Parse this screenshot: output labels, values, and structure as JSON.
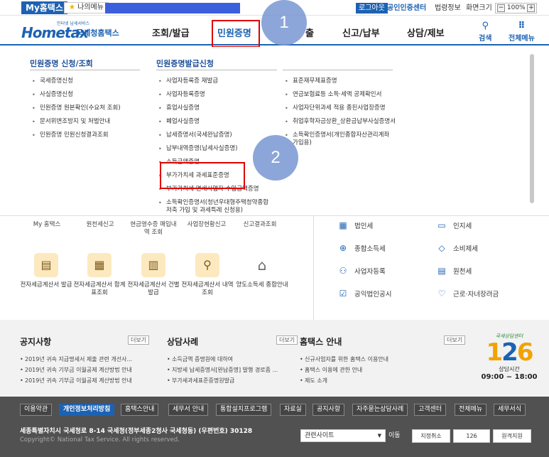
{
  "topbar": {
    "my_hometax": "My홈택스",
    "my_menu_star": "★",
    "my_menu": "나의메뉴",
    "logout": "로그아웃",
    "cert_center": "공인인증센터",
    "legal": "법령정보",
    "zoom_label": "화면크기",
    "zoom_minus": "−",
    "zoom_value": "100%",
    "zoom_plus": "+"
  },
  "header": {
    "logo_word": "Hometax",
    "logo_sub": "인터넷 납세서비스",
    "logo_kr": "국세청홈택스",
    "nav": [
      "조회/발급",
      "민원증명",
      "신청/제출",
      "신고/납부",
      "상담/제보"
    ],
    "nav_visible": [
      "조회/발급",
      "민원증명",
      "출",
      "신고/납부",
      "상담/제보"
    ],
    "search": "검색",
    "search_icon": "⚲",
    "all_menu": "전체메뉴",
    "all_menu_icon": "⠿"
  },
  "annotations": {
    "step1": "1",
    "step2": "2"
  },
  "dropdown": {
    "col1_title": "민원증명 신청/조회",
    "col1_items": [
      "국세증명신청",
      "사실증명신청",
      "민원증명 원본확인(수요처 조회)",
      "문서위변조방지 및 처벌안내",
      "민원증명 민원신청결과조회"
    ],
    "col2_title": "민원증명발급신청",
    "col2_items": [
      "사업자등록증 재발급",
      "사업자등록증명",
      "휴업사실증명",
      "폐업사실증명",
      "납세증명서(국세완납증명)",
      "납부내역증명(납세사실증명)",
      "소득금액증명",
      "부가가치세 과세표준증명",
      "부가가치세 면세사업자 수입금액증명",
      "소득확인증명서(청년우대형주택청약종합저축 가입 및 과세특례 신청용)"
    ],
    "col3_items": [
      "표준재무제표증명",
      "연금보험료등 소득·세액 공제확인서",
      "사업자단위과세 적용 종된사업장증명",
      "취업후학자금상환_상환금납부사실증명서",
      "소득확인증명서(개인종합자산관리계좌 가입용)"
    ]
  },
  "main": {
    "quick_top": [
      "My 홈택스",
      "원천세신고",
      "현금영수증 매입내역 조회",
      "사업장현황신고",
      "신고결과조회"
    ],
    "quick_bottom": [
      "전자세금계산서 발급",
      "전자세금계산서 합계표조회",
      "전자세금계산서 건별발급",
      "전자세금계산서 내역조회",
      "양도소득세 종합안내"
    ],
    "tax_items": [
      {
        "icon": "▦",
        "label": "법인세"
      },
      {
        "icon": "▭",
        "label": "인지세"
      },
      {
        "icon": "⊕",
        "label": "종합소득세"
      },
      {
        "icon": "◇",
        "label": "소비제세"
      },
      {
        "icon": "⚇",
        "label": "사업자등록"
      },
      {
        "icon": "▤",
        "label": "원천세"
      },
      {
        "icon": "☑",
        "label": "공익법인공시"
      },
      {
        "icon": "♡",
        "label": "근로·자녀장려금"
      }
    ]
  },
  "notice": {
    "notice_title": "공지사항",
    "notice_items": [
      "2019년 귀속 지급명세서 제출 관련 개선사...",
      "2019년 귀속 기부금 이월공제 계산방법 안내",
      "2019년 귀속 기부금 이월공제 계산방법 안내"
    ],
    "case_title": "상담사례",
    "case_items": [
      "소득금액 증명원에 대하여",
      "지방세 납세증명서[완납증명] 발행 경로좀 ...",
      "부가세과세표준증명원발급"
    ],
    "guide_title": "홈택스 안내",
    "guide_items": [
      "신규사업자를 위한 홈택스 이용안내",
      "홈택스 이용에 관한 안내",
      "제도 소개"
    ],
    "more": "더보기",
    "call_top": "국세상담센터",
    "call_num_a": "1",
    "call_num_b": "2",
    "call_num_c": "6",
    "call_hours_label": "상담시간",
    "call_hours": "09:00 ~ 18:00"
  },
  "footer": {
    "menu": [
      "이용약관",
      "개인정보처리방침",
      "홈택스안내",
      "세무서 안내",
      "통합설치프로그램",
      "자료실",
      "공지사항",
      "자주묻는상담사례",
      "고객센터",
      "전체메뉴",
      "세무서식"
    ],
    "address": "세종특별자치시 국세청로 8-14 국세청(정부세종2청사 국세청동) (우편번호) 30128",
    "copyright": "Copyright© National Tax Service. All rights reserved.",
    "related_site": "관련사이트",
    "go": "이동",
    "btn1": "지정취소",
    "btn2": "126",
    "btn3": "원격지원"
  }
}
